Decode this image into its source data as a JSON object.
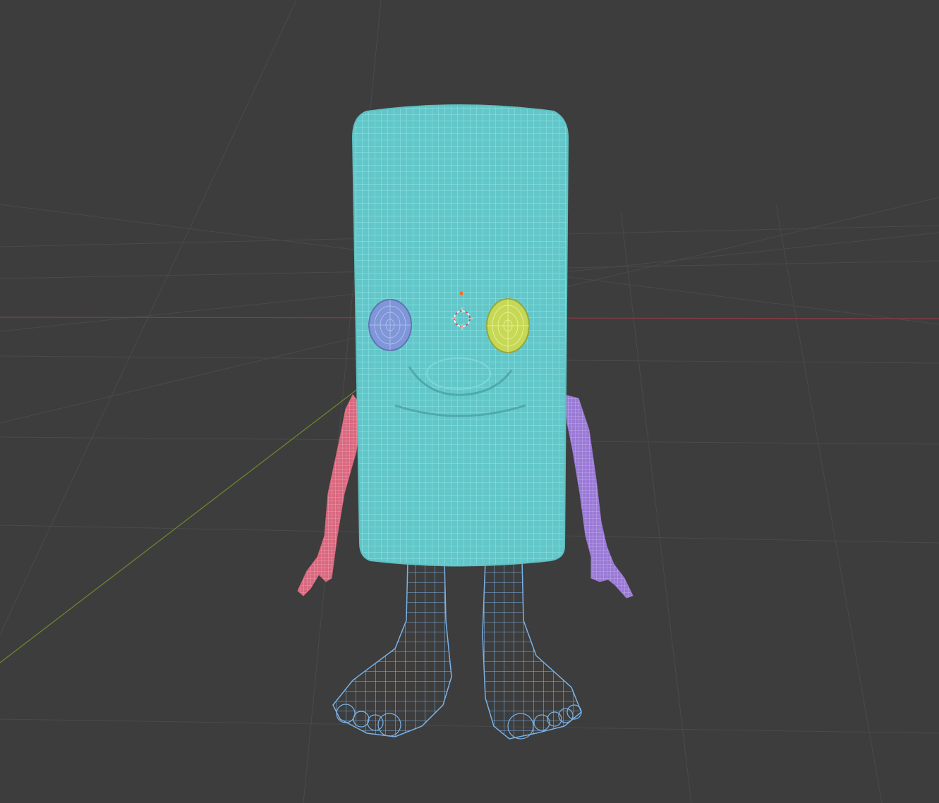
{
  "viewport": {
    "mode": "wireframe-overlay",
    "colors": {
      "background": "#3d3d3d",
      "grid": "#4a4a4a",
      "grid_strong": "#525252",
      "x_axis": "#8a3b45",
      "y_axis": "#6e8a2f"
    }
  },
  "scene": {
    "objects": [
      {
        "name": "body-cylinder",
        "color": "#63c7c9",
        "wire": "#8fe0e4"
      },
      {
        "name": "left-eye",
        "color": "#7f96d8",
        "wire": "#b7c6f2"
      },
      {
        "name": "right-eye",
        "color": "#c6d856",
        "wire": "#e8f39a"
      },
      {
        "name": "left-arm",
        "color": "#d9687f",
        "wire": "#f0a3b3"
      },
      {
        "name": "right-arm",
        "color": "#9a79d6",
        "wire": "#c8b2f0"
      },
      {
        "name": "legs",
        "color": "none",
        "wire": "#7ab3e8"
      }
    ],
    "origin_marker": {
      "color": "#ff6a1a"
    },
    "cursor_3d": {
      "ring_a": "#e04040",
      "ring_b": "#ffffff"
    }
  }
}
